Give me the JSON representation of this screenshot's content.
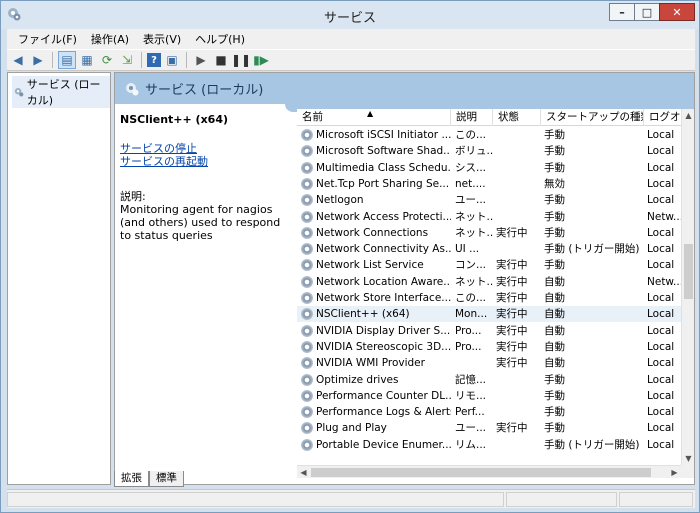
{
  "window": {
    "title": "サービス"
  },
  "menu": [
    "ファイル(F)",
    "操作(A)",
    "表示(V)",
    "ヘルプ(H)"
  ],
  "toolbar": {
    "icons": [
      "back-arrow-icon",
      "forward-arrow-icon",
      "show-tree-icon",
      "properties-icon",
      "refresh-icon",
      "export-icon",
      "help-icon",
      "console-icon",
      "play-icon",
      "stop-icon",
      "pause-icon",
      "restart-icon"
    ]
  },
  "tree": {
    "item": "サービス (ローカル)"
  },
  "main": {
    "header": "サービス (ローカル)"
  },
  "description": {
    "service_name": "NSClient++ (x64)",
    "stop_link": "サービスの停止",
    "restart_link": "サービスの再起動",
    "label": "説明:",
    "text": "Monitoring agent for nagios (and others) used to respond to status queries"
  },
  "columns": {
    "name": "名前",
    "description": "説明",
    "status": "状態",
    "startup": "スタートアップの種類",
    "logon": "ログオン"
  },
  "services": [
    {
      "name": "Microsoft iSCSI Initiator ...",
      "desc": "この...",
      "status": "",
      "startup": "手動",
      "logon": "Local"
    },
    {
      "name": "Microsoft Software Shad...",
      "desc": "ボリュ...",
      "status": "",
      "startup": "手動",
      "logon": "Local"
    },
    {
      "name": "Multimedia Class Schedu...",
      "desc": "シス...",
      "status": "",
      "startup": "手動",
      "logon": "Local"
    },
    {
      "name": "Net.Tcp Port Sharing Se...",
      "desc": "net....",
      "status": "",
      "startup": "無効",
      "logon": "Local"
    },
    {
      "name": "Netlogon",
      "desc": "ユー...",
      "status": "",
      "startup": "手動",
      "logon": "Local"
    },
    {
      "name": "Network Access Protecti...",
      "desc": "ネット...",
      "status": "",
      "startup": "手動",
      "logon": "Netw..."
    },
    {
      "name": "Network Connections",
      "desc": "ネット...",
      "status": "実行中",
      "startup": "手動",
      "logon": "Local"
    },
    {
      "name": "Network Connectivity As...",
      "desc": "UI ...",
      "status": "",
      "startup": "手動 (トリガー開始)",
      "logon": "Local"
    },
    {
      "name": "Network List Service",
      "desc": "コン...",
      "status": "実行中",
      "startup": "手動",
      "logon": "Local"
    },
    {
      "name": "Network Location Aware...",
      "desc": "ネット...",
      "status": "実行中",
      "startup": "自動",
      "logon": "Netw..."
    },
    {
      "name": "Network Store Interface...",
      "desc": "この...",
      "status": "実行中",
      "startup": "自動",
      "logon": "Local"
    },
    {
      "name": "NSClient++ (x64)",
      "desc": "Mon...",
      "status": "実行中",
      "startup": "自動",
      "logon": "Local"
    },
    {
      "name": "NVIDIA Display Driver S...",
      "desc": "Pro...",
      "status": "実行中",
      "startup": "自動",
      "logon": "Local"
    },
    {
      "name": "NVIDIA Stereoscopic 3D...",
      "desc": "Pro...",
      "status": "実行中",
      "startup": "自動",
      "logon": "Local"
    },
    {
      "name": "NVIDIA WMI Provider",
      "desc": "",
      "status": "実行中",
      "startup": "自動",
      "logon": "Local"
    },
    {
      "name": "Optimize drives",
      "desc": "記憶...",
      "status": "",
      "startup": "手動",
      "logon": "Local"
    },
    {
      "name": "Performance Counter DL...",
      "desc": "リモ...",
      "status": "",
      "startup": "手動",
      "logon": "Local"
    },
    {
      "name": "Performance Logs & Alerts",
      "desc": "Perf...",
      "status": "",
      "startup": "手動",
      "logon": "Local"
    },
    {
      "name": "Plug and Play",
      "desc": "ユー...",
      "status": "実行中",
      "startup": "手動",
      "logon": "Local"
    },
    {
      "name": "Portable Device Enumer...",
      "desc": "リム...",
      "status": "",
      "startup": "手動 (トリガー開始)",
      "logon": "Local"
    }
  ],
  "selected_service": "NSClient++ (x64)",
  "tabs": [
    "拡張",
    "標準"
  ],
  "active_tab": "拡張"
}
